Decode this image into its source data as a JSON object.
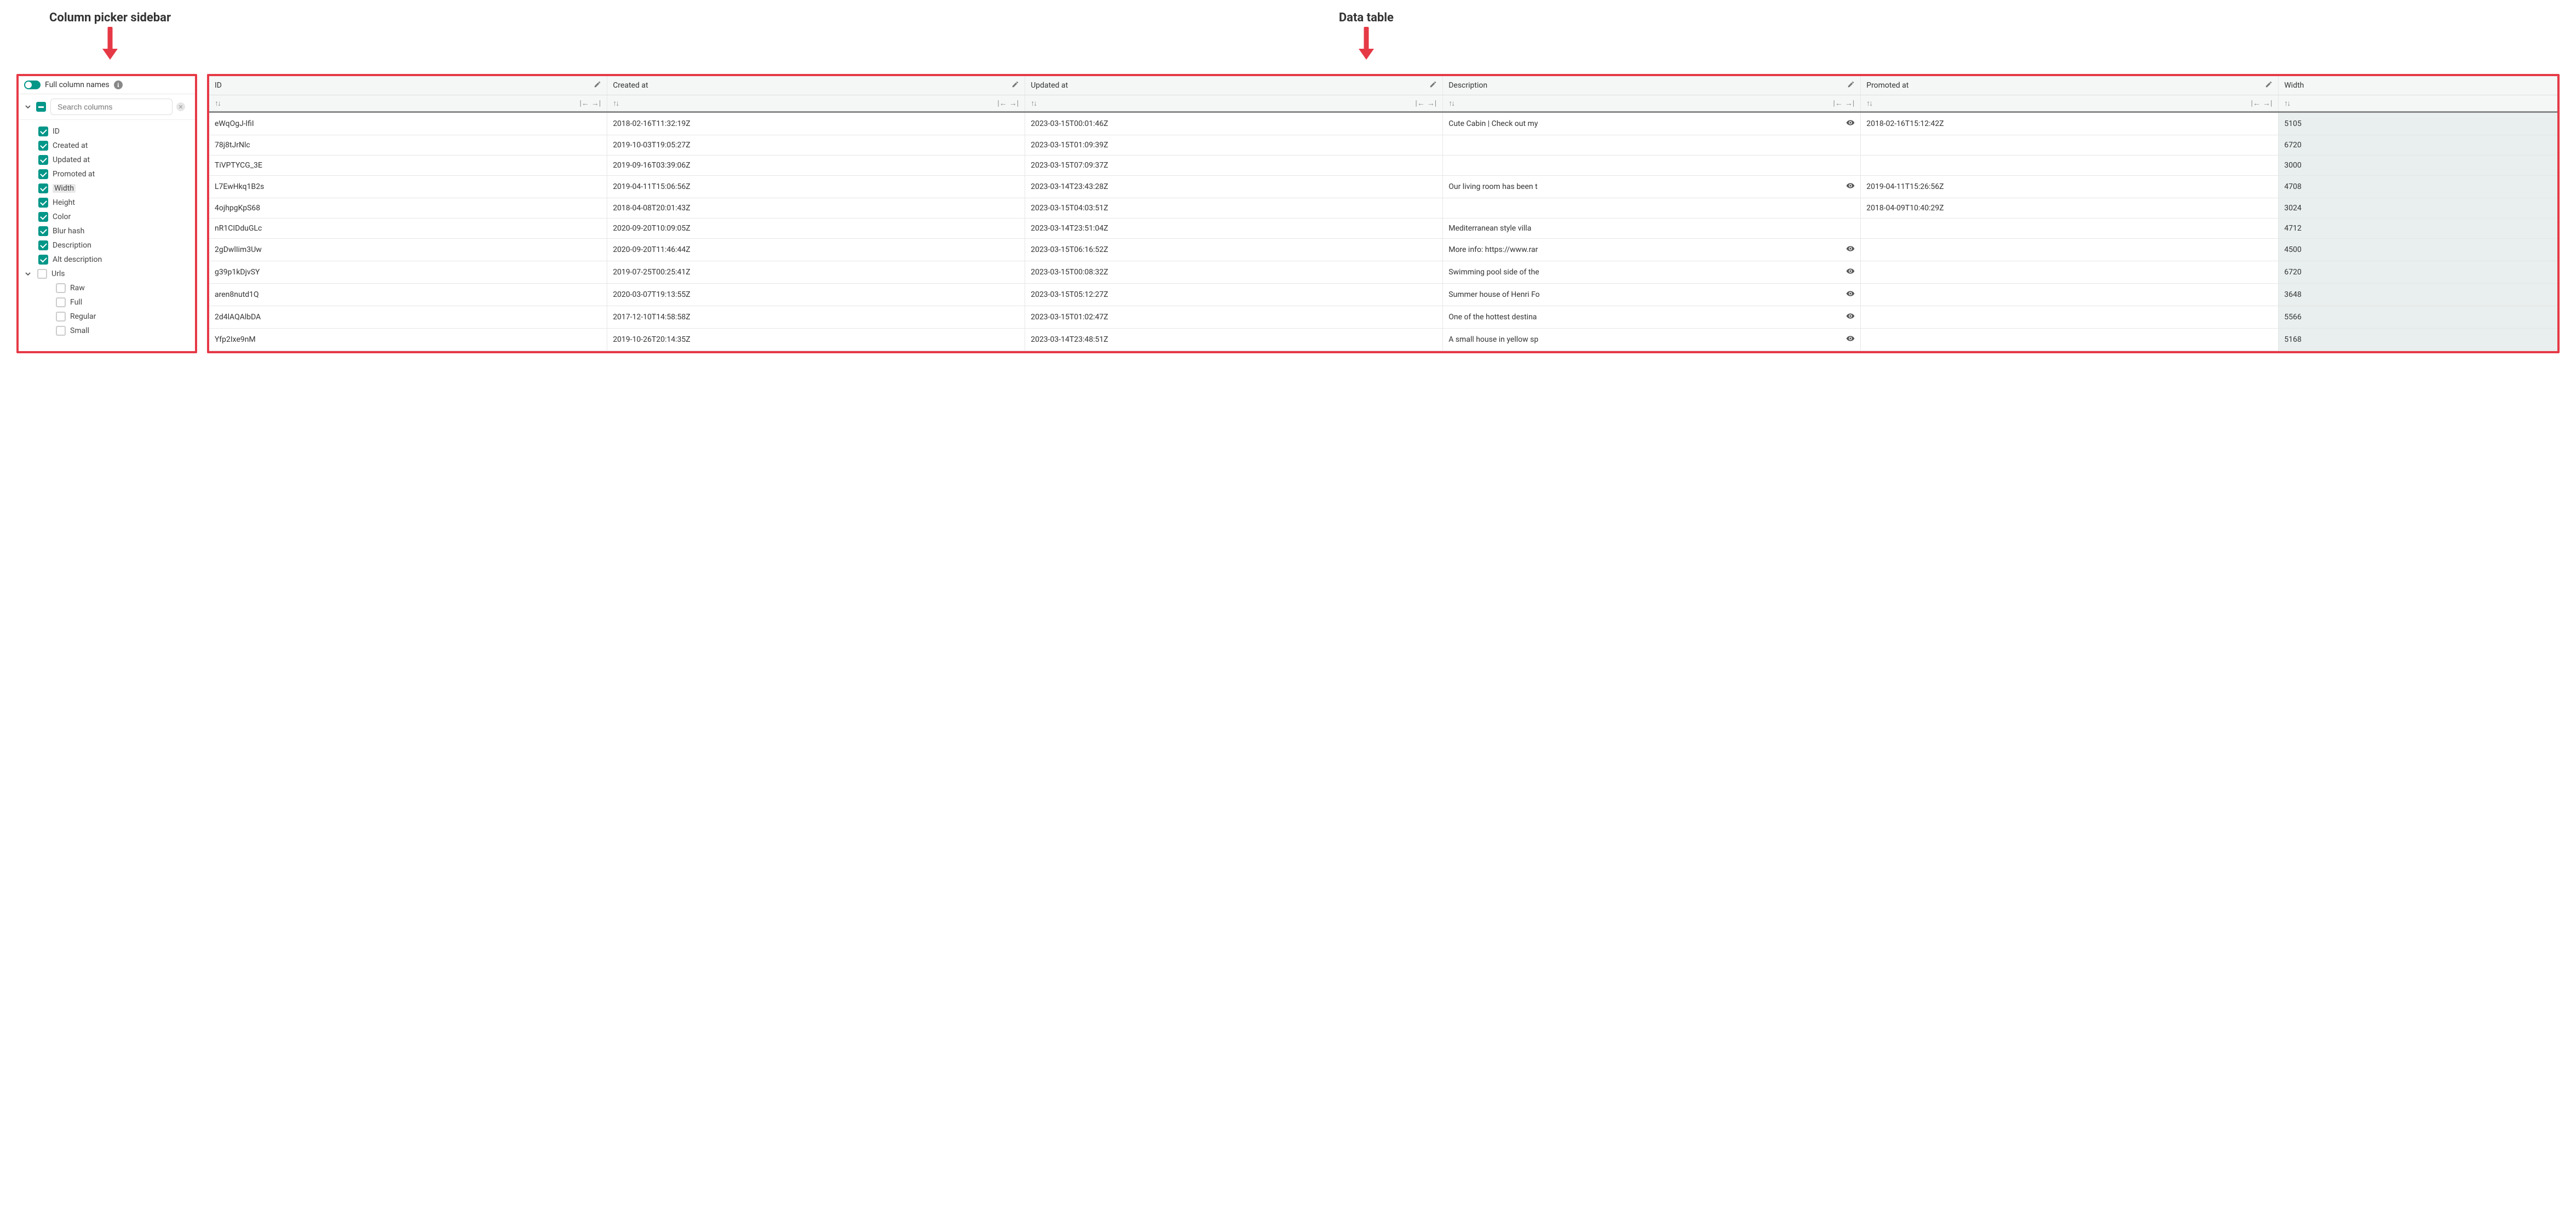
{
  "annotations": {
    "sidebar_label": "Column picker sidebar",
    "table_label": "Data table"
  },
  "sidebar": {
    "toggle_label": "Full column names",
    "search_placeholder": "Search columns",
    "columns": [
      {
        "label": "ID",
        "checked": true
      },
      {
        "label": "Created at",
        "checked": true
      },
      {
        "label": "Updated at",
        "checked": true
      },
      {
        "label": "Promoted at",
        "checked": true
      },
      {
        "label": "Width",
        "checked": true,
        "highlight": true
      },
      {
        "label": "Height",
        "checked": true
      },
      {
        "label": "Color",
        "checked": true
      },
      {
        "label": "Blur hash",
        "checked": true
      },
      {
        "label": "Description",
        "checked": true
      },
      {
        "label": "Alt description",
        "checked": true
      }
    ],
    "group": {
      "label": "Urls",
      "checked": false,
      "children": [
        {
          "label": "Raw",
          "checked": false
        },
        {
          "label": "Full",
          "checked": false
        },
        {
          "label": "Regular",
          "checked": false
        },
        {
          "label": "Small",
          "checked": false
        }
      ]
    }
  },
  "table": {
    "headers": [
      {
        "label": "ID",
        "frozen": false
      },
      {
        "label": "Created at",
        "frozen": false
      },
      {
        "label": "Updated at",
        "frozen": false
      },
      {
        "label": "Description",
        "frozen": false
      },
      {
        "label": "Promoted at",
        "frozen": false
      },
      {
        "label": "Width",
        "frozen": true
      }
    ],
    "rows": [
      {
        "id": "eWqOgJ-lfiI",
        "created": "2018-02-16T11:32:19Z",
        "updated": "2023-03-15T00:01:46Z",
        "description": "Cute Cabin | Check out my",
        "desc_trunc": true,
        "promoted": "2018-02-16T15:12:42Z",
        "width": "5105"
      },
      {
        "id": "78j8tJrNlc",
        "created": "2019-10-03T19:05:27Z",
        "updated": "2023-03-15T01:09:39Z",
        "description": "",
        "desc_trunc": false,
        "promoted": "",
        "width": "6720"
      },
      {
        "id": "TiVPTYCG_3E",
        "created": "2019-09-16T03:39:06Z",
        "updated": "2023-03-15T07:09:37Z",
        "description": "",
        "desc_trunc": false,
        "promoted": "",
        "width": "3000"
      },
      {
        "id": "L7EwHkq1B2s",
        "created": "2019-04-11T15:06:56Z",
        "updated": "2023-03-14T23:43:28Z",
        "description": "Our living room has been t",
        "desc_trunc": true,
        "promoted": "2019-04-11T15:26:56Z",
        "width": "4708"
      },
      {
        "id": "4ojhpgKpS68",
        "created": "2018-04-08T20:01:43Z",
        "updated": "2023-03-15T04:03:51Z",
        "description": "",
        "desc_trunc": false,
        "promoted": "2018-04-09T10:40:29Z",
        "width": "3024"
      },
      {
        "id": "nR1CIDduGLc",
        "created": "2020-09-20T10:09:05Z",
        "updated": "2023-03-14T23:51:04Z",
        "description": "Mediterranean style villa",
        "desc_trunc": false,
        "promoted": "",
        "width": "4712"
      },
      {
        "id": "2gDwlIim3Uw",
        "created": "2020-09-20T11:46:44Z",
        "updated": "2023-03-15T06:16:52Z",
        "description": "More info: https://www.rar",
        "desc_trunc": true,
        "promoted": "",
        "width": "4500"
      },
      {
        "id": "g39p1kDjvSY",
        "created": "2019-07-25T00:25:41Z",
        "updated": "2023-03-15T00:08:32Z",
        "description": "Swimming pool side of the",
        "desc_trunc": true,
        "promoted": "",
        "width": "6720"
      },
      {
        "id": "aren8nutd1Q",
        "created": "2020-03-07T19:13:55Z",
        "updated": "2023-03-15T05:12:27Z",
        "description": "Summer house of Henri Fo",
        "desc_trunc": true,
        "promoted": "",
        "width": "3648"
      },
      {
        "id": "2d4lAQAlbDA",
        "created": "2017-12-10T14:58:58Z",
        "updated": "2023-03-15T01:02:47Z",
        "description": "One of the hottest destina",
        "desc_trunc": true,
        "promoted": "",
        "width": "5566"
      },
      {
        "id": "Yfp2Ixe9nM",
        "created": "2019-10-26T20:14:35Z",
        "updated": "2023-03-14T23:48:51Z",
        "description": "A small house in yellow sp",
        "desc_trunc": true,
        "promoted": "",
        "width": "5168"
      }
    ]
  }
}
